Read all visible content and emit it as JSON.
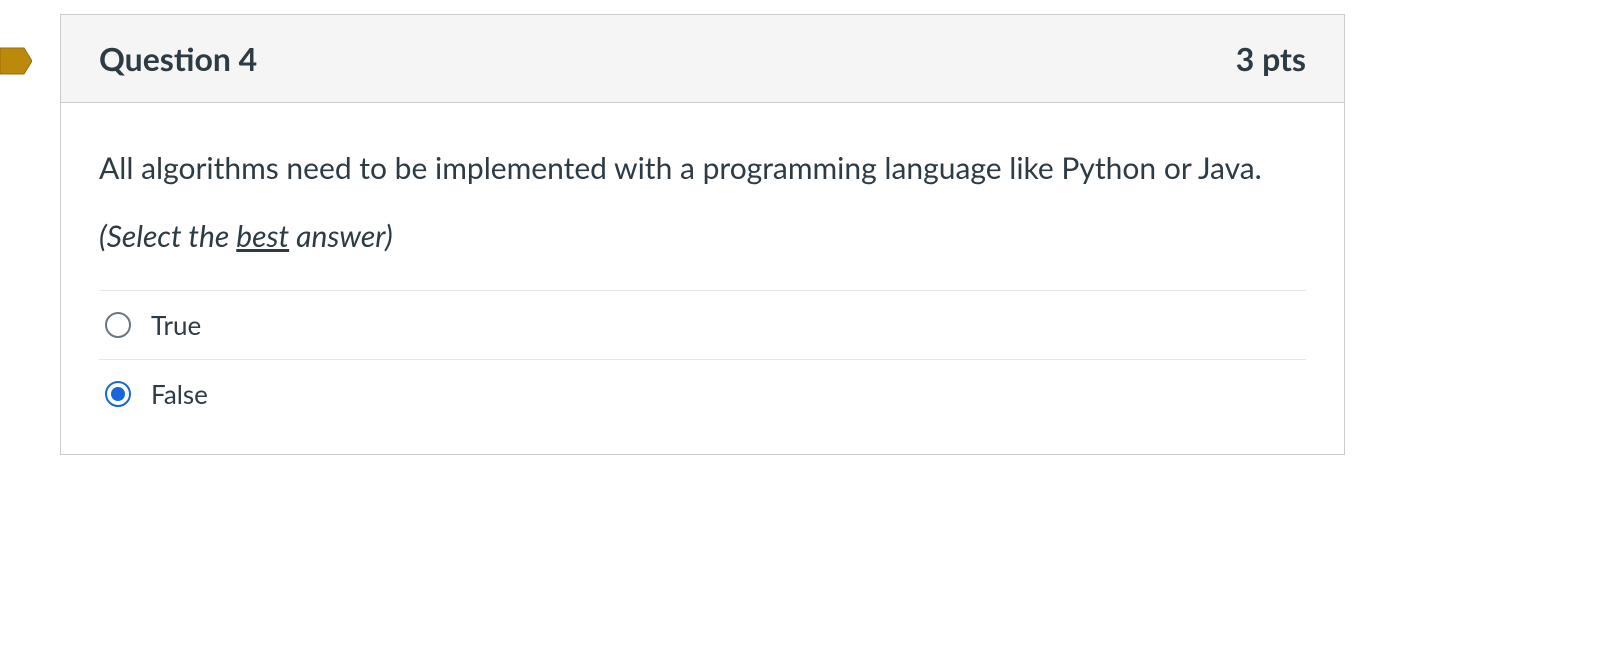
{
  "question": {
    "title": "Question 4",
    "points": "3 pts",
    "text": "All algorithms need to be implemented with a programming language like Python or Java.",
    "hint_pre": "(Select the ",
    "hint_underline": "best",
    "hint_post": " answer)",
    "options": [
      {
        "label": "True",
        "selected": false
      },
      {
        "label": "False",
        "selected": true
      }
    ]
  }
}
